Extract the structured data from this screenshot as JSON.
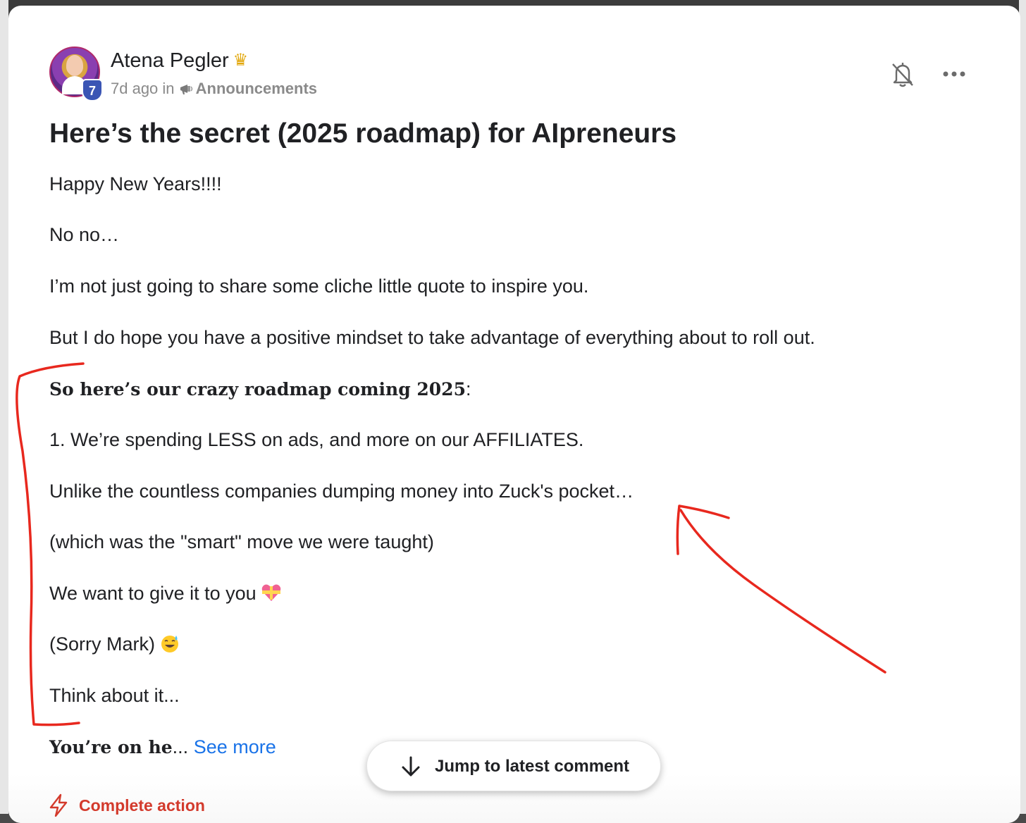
{
  "post": {
    "author": "Atena Pegler",
    "author_level": "7",
    "time_ago": "7d ago",
    "in_label": "in",
    "category": "Announcements",
    "title": "Here’s the secret (2025 roadmap) for AIpreneurs"
  },
  "body": {
    "p1": "Happy New Years!!!!",
    "p2": "No no…",
    "p3": "I’m not just going to share some cliche little quote to inspire you.",
    "p4": "But I do hope you have a positive mindset to take advantage of everything about to roll out.",
    "p5_bold": "So here’s our crazy roadmap coming 2025",
    "p5_tail": ":",
    "p6": "1. We’re spending LESS on ads, and more on our AFFILIATES.",
    "p7": "Unlike the countless companies dumping money into Zuck's pocket…",
    "p8": "(which was the \"smart\" move we were taught)",
    "p9": "We want to give it to you",
    "p10": "(Sorry Mark)",
    "p11": "Think about it...",
    "p12_bold": "You’re on he",
    "p12_ellipsis": "...",
    "see_more": "See more"
  },
  "icons": {
    "crown": "crown-icon",
    "megaphone": "megaphone-icon",
    "bell": "bell-off-icon",
    "more": "more-horizontal-icon",
    "heart": "heart-gift-emoji",
    "sweat_smile": "sweat-smile-emoji",
    "arrow_down": "arrow-down-icon",
    "bolt": "lightning-bolt-icon"
  },
  "actions": {
    "jump_label": "Jump to latest comment",
    "complete_action": "Complete action"
  },
  "colors": {
    "accent_blue": "#1a73e8",
    "action_red": "#d33a2c",
    "annotation_red": "#e8281e",
    "level_badge": "#3a55b4"
  }
}
